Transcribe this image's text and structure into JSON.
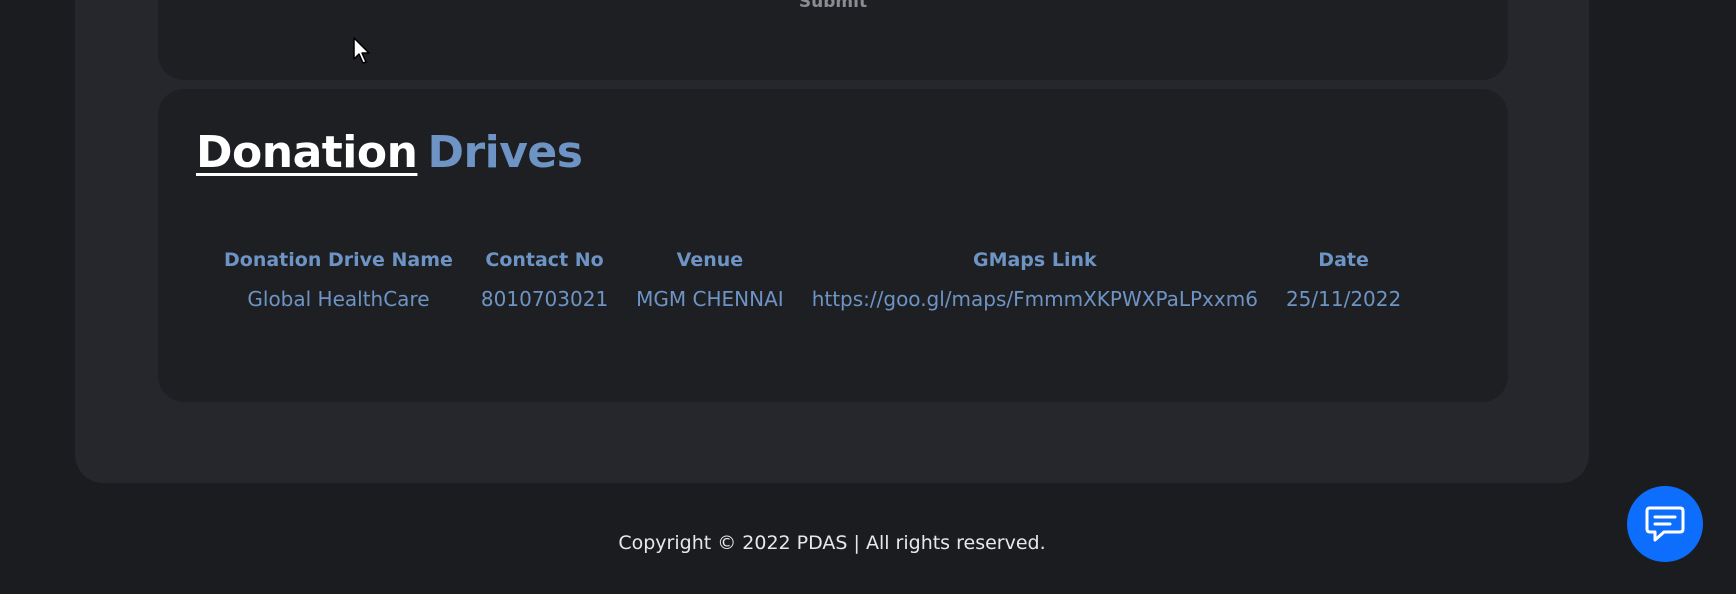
{
  "previous_card": {
    "label": "Submit"
  },
  "donation_drives": {
    "title_main": "Donation",
    "title_accent": "Drives",
    "headers": [
      "Donation Drive Name",
      "Contact No",
      "Venue",
      "GMaps Link",
      "Date"
    ],
    "rows": [
      {
        "name": "Global HealthCare",
        "contact": "8010703021",
        "venue": "MGM CHENNAI",
        "gmaps_link": "https://goo.gl/maps/FmmmXKPWXPaLPxxm6",
        "date": "25/11/2022"
      }
    ]
  },
  "footer": {
    "copyright": "Copyright © 2022 PDAS | All rights reserved."
  },
  "chat_button": {
    "icon": "chat-icon",
    "color": "#0d6efd"
  },
  "colors": {
    "background": "#1b1c20",
    "panel": "#26272c",
    "card": "#1e1f23",
    "accent": "#6d94c4",
    "title": "#ffffff"
  }
}
